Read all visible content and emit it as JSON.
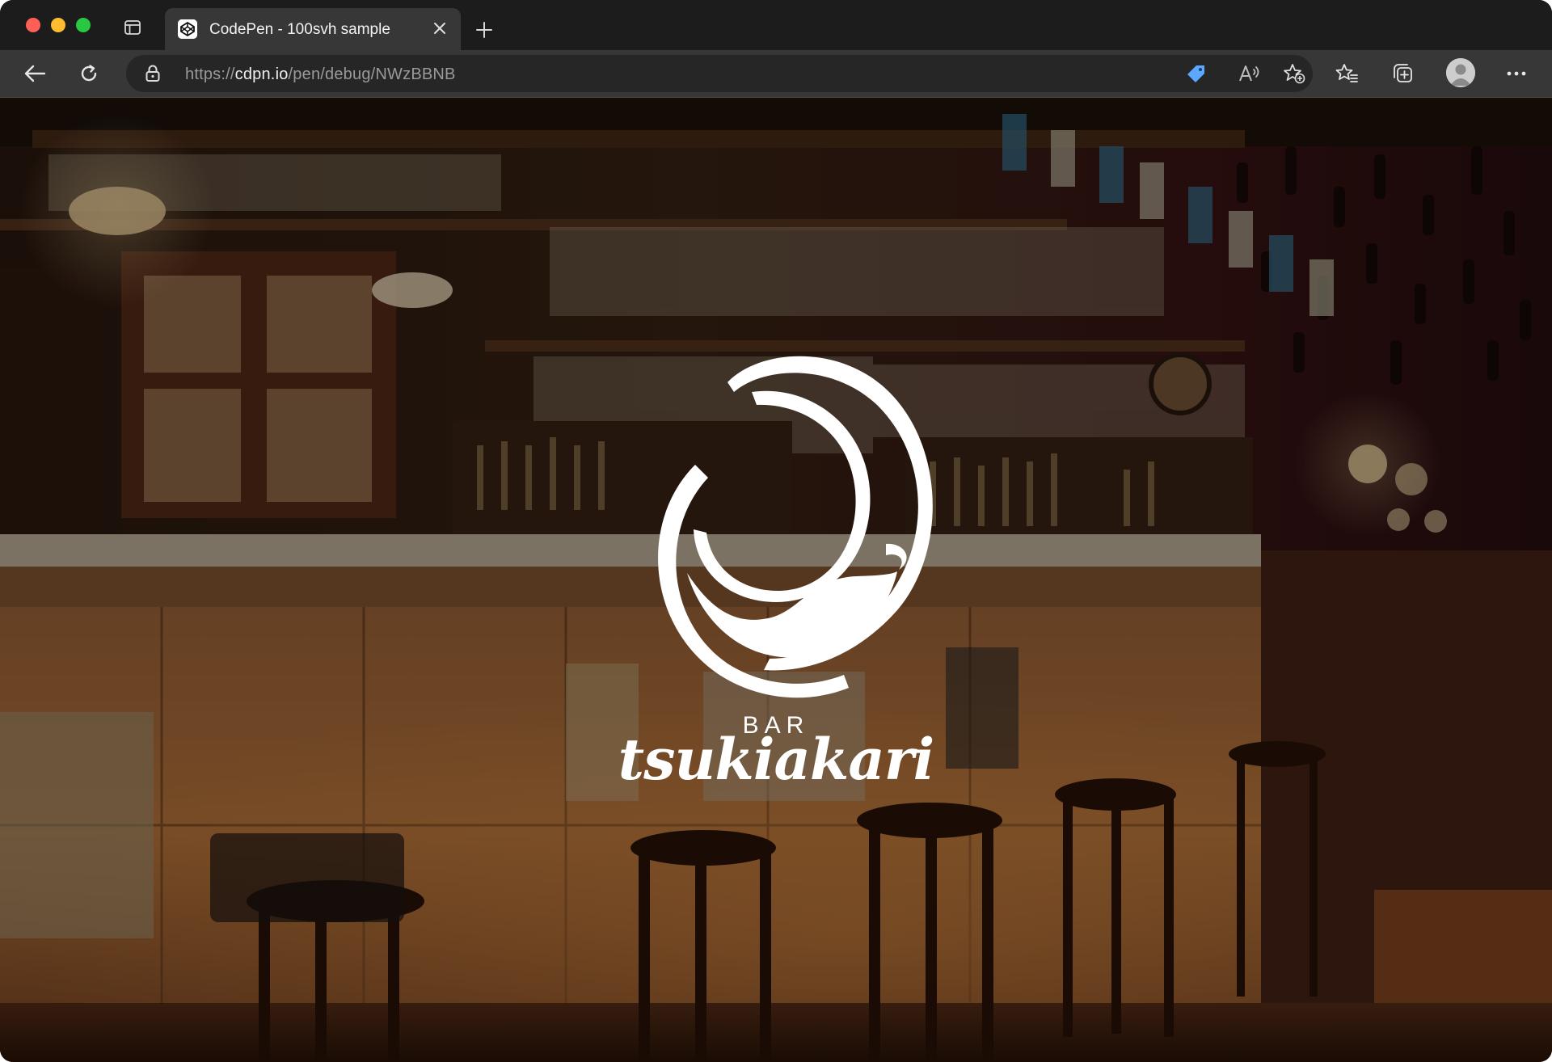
{
  "browser": {
    "tab": {
      "title": "CodePen - 100svh sample"
    },
    "address": {
      "scheme": "https://",
      "host": "cdpn.io",
      "path": "/pen/debug/NWzBBNB"
    }
  },
  "page": {
    "logo": {
      "label": "BAR",
      "name": "tsukiakari"
    }
  },
  "colors": {
    "chrome_dark": "#1c1c1c",
    "toolbar": "#373737",
    "address_field": "#262626",
    "traffic_red": "#ff5f57",
    "traffic_yellow": "#febc2e",
    "traffic_green": "#28c840",
    "coupon_icon": "#5aa8ff",
    "logo": "#ffffff"
  },
  "icons": {
    "sidebar": "sidebar-toggle-icon",
    "tab_favicon": "codepen-icon",
    "tab_close": "close-icon",
    "new_tab": "plus-icon",
    "back": "back-arrow-icon",
    "reload": "reload-icon",
    "lock": "lock-icon",
    "coupon": "tag-icon",
    "read_aloud": "read-aloud-icon",
    "add_favorite": "star-plus-icon",
    "favorites": "favorites-icon",
    "collections": "collections-icon",
    "profile": "profile-avatar",
    "menu": "more-icon"
  }
}
